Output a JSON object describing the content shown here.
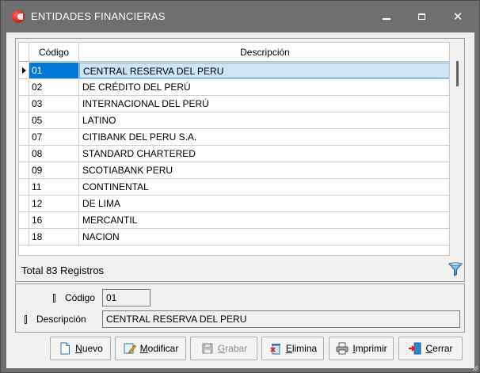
{
  "window": {
    "title": "ENTIDADES FINANCIERAS",
    "minimize_glyph": "–",
    "close_glyph": "✕"
  },
  "grid": {
    "columns": {
      "code": "Código",
      "description": "Descripción"
    },
    "rows": [
      {
        "code": "01",
        "description": "CENTRAL RESERVA DEL PERU"
      },
      {
        "code": "02",
        "description": "DE CRÉDITO DEL PERÚ"
      },
      {
        "code": "03",
        "description": "INTERNACIONAL DEL PERÚ"
      },
      {
        "code": "05",
        "description": "LATINO"
      },
      {
        "code": "07",
        "description": "CITIBANK DEL PERU S.A."
      },
      {
        "code": "08",
        "description": "STANDARD CHARTERED"
      },
      {
        "code": "09",
        "description": "SCOTIABANK PERU"
      },
      {
        "code": "11",
        "description": "CONTINENTAL"
      },
      {
        "code": "12",
        "description": "DE LIMA"
      },
      {
        "code": "16",
        "description": "MERCANTIL"
      },
      {
        "code": "18",
        "description": "NACION"
      }
    ],
    "selected_index": 0,
    "total_label": "Total 83 Registros"
  },
  "detail": {
    "code_label": "Código",
    "code_value": "01",
    "description_label": "Descripción",
    "description_value": "CENTRAL RESERVA DEL PERU"
  },
  "buttons": {
    "nuevo": "Nuevo",
    "modificar": "Modificar",
    "grabar": "Grabar",
    "elimina": "Elimina",
    "imprimir": "Imprimir",
    "cerrar": "Cerrar"
  },
  "icons": {
    "app": "app-logo-icon",
    "filter": "filter-icon",
    "new": "new-document-icon",
    "edit": "edit-icon",
    "save": "save-icon",
    "delete": "delete-icon",
    "print": "printer-icon",
    "exit": "exit-door-icon"
  },
  "colors": {
    "titlebar": "#6f6f6f",
    "selection": "#0078d7",
    "selection_row": "#cde6f7"
  }
}
